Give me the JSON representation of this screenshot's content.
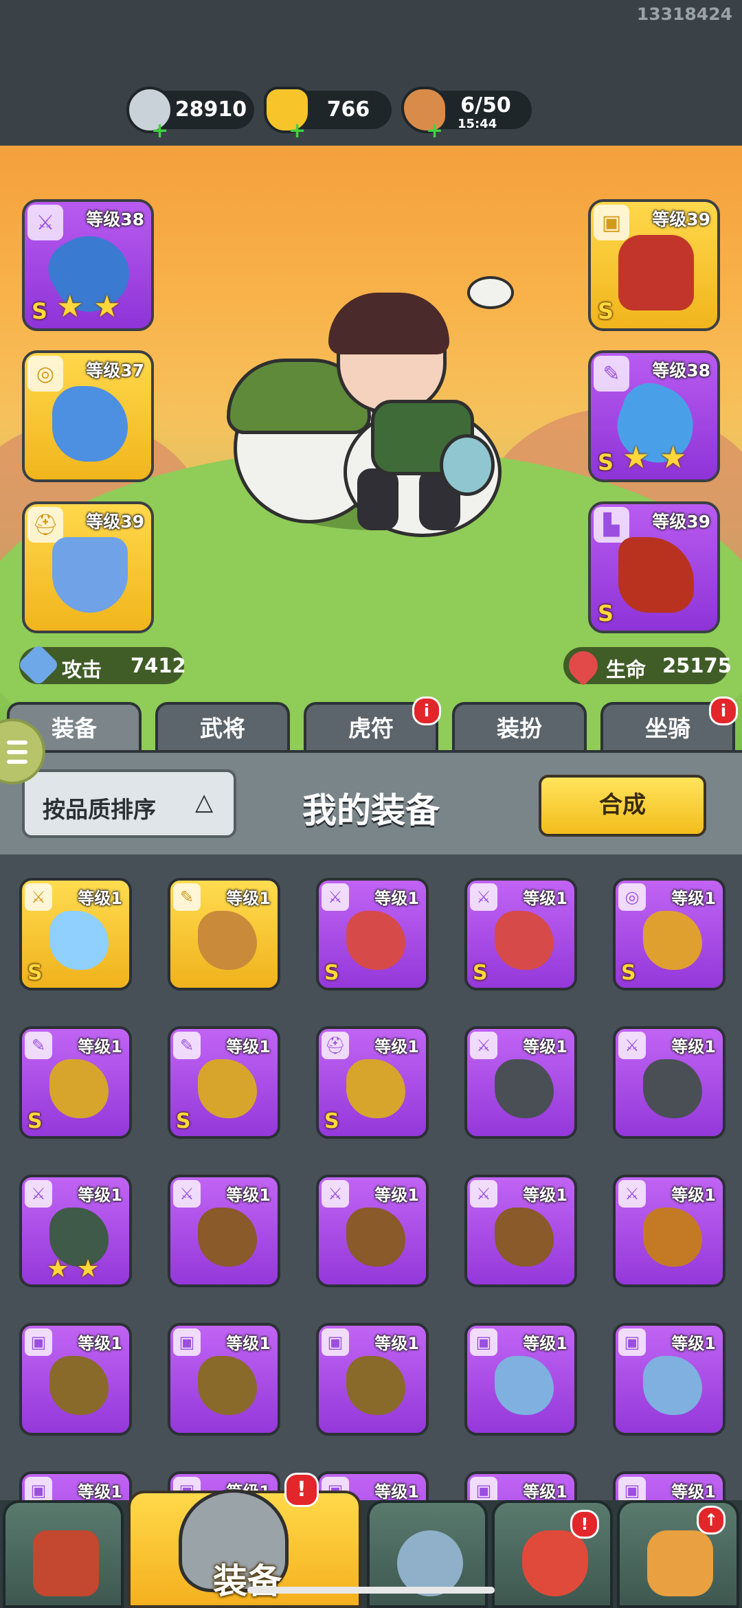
{
  "uid": "13318424",
  "resources": [
    {
      "name": "silver-coin",
      "value": "28910",
      "color": "#c9d2d8"
    },
    {
      "name": "gold-ingot",
      "value": "766",
      "color": "#f7c52a"
    },
    {
      "name": "meat-stamina",
      "value": "6/50",
      "timer": "15:44",
      "color": "#d98b4a"
    }
  ],
  "equipped_left": [
    {
      "icon": "sword-icon",
      "level": "等级38",
      "rank": "S",
      "stars": 2,
      "quality": "purple"
    },
    {
      "icon": "medal-icon",
      "level": "等级37",
      "rank": "",
      "stars": 0,
      "quality": "gold"
    },
    {
      "icon": "helmet-icon",
      "level": "等级39",
      "rank": "",
      "stars": 0,
      "quality": "gold"
    }
  ],
  "equipped_right": [
    {
      "icon": "armor-icon",
      "level": "等级39",
      "rank": "S",
      "stars": 0,
      "quality": "gold"
    },
    {
      "icon": "scroll-icon",
      "level": "等级38",
      "rank": "S",
      "stars": 2,
      "quality": "purple"
    },
    {
      "icon": "boot-icon",
      "level": "等级39",
      "rank": "S",
      "stars": 0,
      "quality": "purple"
    }
  ],
  "stats": {
    "attack_label": "攻击",
    "attack_value": "7412",
    "hp_label": "生命",
    "hp_value": "25175"
  },
  "tabs": [
    {
      "label": "装备",
      "badge": false,
      "active": true
    },
    {
      "label": "武将",
      "badge": false,
      "active": false
    },
    {
      "label": "虎符",
      "badge": true,
      "active": false
    },
    {
      "label": "装扮",
      "badge": false,
      "active": false
    },
    {
      "label": "坐骑",
      "badge": true,
      "active": false
    }
  ],
  "badge_mark": "i",
  "panel": {
    "sort_label": "按品质排序",
    "sort_arrow": "△",
    "title": "我的装备",
    "merge_label": "合成"
  },
  "inventory": [
    {
      "icon": "sword-icon",
      "level": "等级1",
      "rank": "S",
      "stars": 0,
      "quality": "gold",
      "art": "#8fd0ff"
    },
    {
      "icon": "scroll-icon",
      "level": "等级1",
      "rank": "",
      "stars": 0,
      "quality": "gold",
      "art": "#c98a3a"
    },
    {
      "icon": "sword-icon",
      "level": "等级1",
      "rank": "S",
      "stars": 0,
      "quality": "purple",
      "art": "#d64a4a"
    },
    {
      "icon": "sword-icon",
      "level": "等级1",
      "rank": "S",
      "stars": 0,
      "quality": "purple",
      "art": "#d64a4a"
    },
    {
      "icon": "medal-icon",
      "level": "等级1",
      "rank": "S",
      "stars": 0,
      "quality": "purple",
      "art": "#e0a030"
    },
    {
      "icon": "scroll-icon",
      "level": "等级1",
      "rank": "S",
      "stars": 0,
      "quality": "purple",
      "art": "#d8a52c"
    },
    {
      "icon": "scroll-icon",
      "level": "等级1",
      "rank": "S",
      "stars": 0,
      "quality": "purple",
      "art": "#d8a52c"
    },
    {
      "icon": "helmet-icon",
      "level": "等级1",
      "rank": "S",
      "stars": 0,
      "quality": "purple",
      "art": "#d8a52c"
    },
    {
      "icon": "sword-icon",
      "level": "等级1",
      "rank": "",
      "stars": 0,
      "quality": "purple",
      "art": "#4a4f56"
    },
    {
      "icon": "sword-icon",
      "level": "等级1",
      "rank": "",
      "stars": 0,
      "quality": "purple",
      "art": "#4a4f56"
    },
    {
      "icon": "sword-icon",
      "level": "等级1",
      "rank": "",
      "stars": 2,
      "quality": "purple",
      "art": "#3f5a48"
    },
    {
      "icon": "sword-icon",
      "level": "等级1",
      "rank": "",
      "stars": 0,
      "quality": "purple",
      "art": "#8a5a2a"
    },
    {
      "icon": "sword-icon",
      "level": "等级1",
      "rank": "",
      "stars": 0,
      "quality": "purple",
      "art": "#8a5a2a"
    },
    {
      "icon": "sword-icon",
      "level": "等级1",
      "rank": "",
      "stars": 0,
      "quality": "purple",
      "art": "#8a5a2a"
    },
    {
      "icon": "sword-icon",
      "level": "等级1",
      "rank": "",
      "stars": 0,
      "quality": "purple",
      "art": "#c47a24"
    },
    {
      "icon": "armor-icon",
      "level": "等级1",
      "rank": "",
      "stars": 0,
      "quality": "purple",
      "art": "#8a6a2a"
    },
    {
      "icon": "armor-icon",
      "level": "等级1",
      "rank": "",
      "stars": 0,
      "quality": "purple",
      "art": "#8a6a2a"
    },
    {
      "icon": "armor-icon",
      "level": "等级1",
      "rank": "",
      "stars": 0,
      "quality": "purple",
      "art": "#8a6a2a"
    },
    {
      "icon": "armor-icon",
      "level": "等级1",
      "rank": "",
      "stars": 0,
      "quality": "purple",
      "art": "#7fb0e0"
    },
    {
      "icon": "armor-icon",
      "level": "等级1",
      "rank": "",
      "stars": 0,
      "quality": "purple",
      "art": "#7fb0e0"
    },
    {
      "icon": "armor-icon",
      "level": "等级1",
      "rank": "",
      "stars": 0,
      "quality": "purple",
      "art": "#6a4a2a"
    },
    {
      "icon": "armor-icon",
      "level": "等级1",
      "rank": "",
      "stars": 0,
      "quality": "purple",
      "art": "#6a4a2a"
    },
    {
      "icon": "armor-icon",
      "level": "等级1",
      "rank": "",
      "stars": 0,
      "quality": "purple",
      "art": "#6a4a2a"
    },
    {
      "icon": "armor-icon",
      "level": "等级1",
      "rank": "",
      "stars": 0,
      "quality": "purple",
      "art": "#6a4a2a"
    },
    {
      "icon": "armor-icon",
      "level": "等级1",
      "rank": "",
      "stars": 0,
      "quality": "purple",
      "art": "#6a4a2a"
    }
  ],
  "bottom_nav": [
    {
      "name": "nav-city",
      "icon": "palace-icon",
      "badge": "",
      "color": "#c4472f"
    },
    {
      "name": "nav-equipment",
      "icon": "helmet-icon",
      "label": "装备",
      "badge": "!",
      "active": true
    },
    {
      "name": "nav-battle",
      "icon": "crossed-swords-icon",
      "badge": "",
      "color": "#8fb0c8"
    },
    {
      "name": "nav-heroes",
      "icon": "hero-icon",
      "badge": "!",
      "color": "#e04a3a"
    },
    {
      "name": "nav-upgrade",
      "icon": "fist-up-icon",
      "badge": "↑",
      "color": "#e8a040"
    }
  ],
  "colors": {
    "purple": "#a84ee6",
    "gold": "#f6c52d",
    "badge_red": "#e2262a",
    "plus_green": "#43d13f"
  }
}
